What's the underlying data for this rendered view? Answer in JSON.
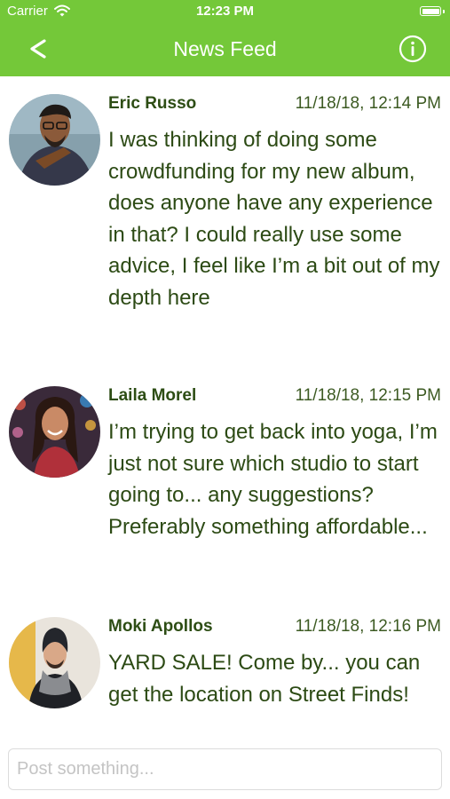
{
  "status_bar": {
    "carrier": "Carrier",
    "time": "12:23 PM"
  },
  "nav": {
    "title": "News Feed",
    "back_icon": "chevron-left-icon",
    "info_icon": "info-circle-icon"
  },
  "posts": [
    {
      "author": "Eric Russo",
      "timestamp": "11/18/18, 12:14 PM",
      "text": "I was thinking of doing some crowdfunding for my new album, does anyone have any experience in that? I could really use some advice, I feel like I’m a bit out of my depth here"
    },
    {
      "author": "Laila Morel",
      "timestamp": "11/18/18, 12:15 PM",
      "text": "I’m trying to get back into yoga, I’m just not sure which studio to start going to... any suggestions? Preferably something affordable..."
    },
    {
      "author": "Moki Apollos",
      "timestamp": "11/18/18, 12:16 PM",
      "text": "YARD SALE! Come by... you can get the location on Street Finds!"
    }
  ],
  "composer": {
    "placeholder": "Post something..."
  },
  "colors": {
    "accent": "#74c839",
    "author_text": "#2d4d14",
    "body_text": "#2c4a14"
  }
}
